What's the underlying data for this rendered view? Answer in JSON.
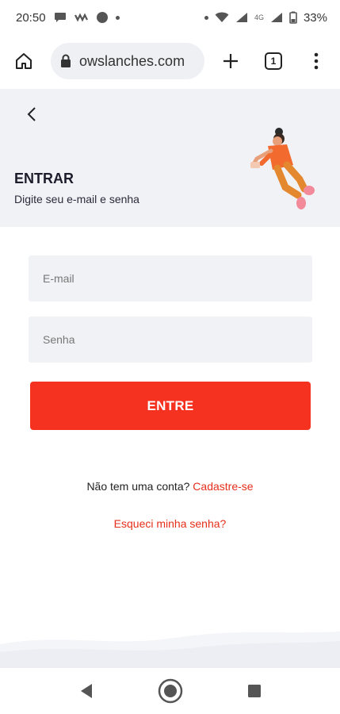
{
  "status_bar": {
    "time": "20:50",
    "network": "4G",
    "battery": "33%",
    "icons": [
      "chat-bubble-icon",
      "voicemail-icon",
      "circle-icon",
      "dot-icon",
      "wifi-icon",
      "signal-icon",
      "battery-icon"
    ]
  },
  "browser": {
    "url": "owslanches.com",
    "tab_count": "1",
    "icons": [
      "home-icon",
      "lock-icon",
      "plus-icon",
      "tabs-icon",
      "more-vert-icon"
    ]
  },
  "header": {
    "title": "ENTRAR",
    "subtitle": "Digite seu e-mail e senha"
  },
  "form": {
    "email_placeholder": "E-mail",
    "password_placeholder": "Senha",
    "submit_label": "ENTRE"
  },
  "links": {
    "signup_prompt": "Não tem uma conta?",
    "signup_link": "Cadastre-se",
    "forgot_link": "Esqueci minha senha?"
  },
  "colors": {
    "accent": "#f5311f",
    "header_bg": "#f1f2f6",
    "link": "#e62e1b"
  }
}
